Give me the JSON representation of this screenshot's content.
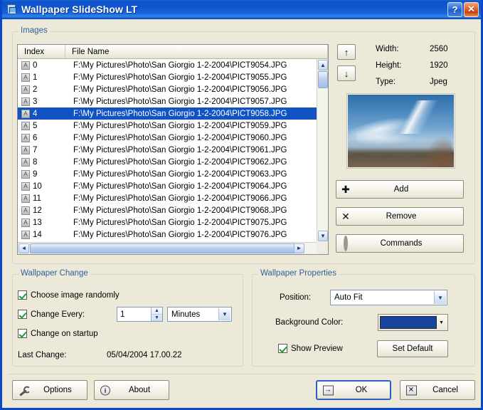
{
  "window": {
    "title": "Wallpaper SlideShow LT",
    "app_icon": "wallpaper-app-icon",
    "help_button": "?",
    "close_button": "✕"
  },
  "images_group": {
    "legend": "Images",
    "columns": [
      "Index",
      "File Name"
    ],
    "row_icon": "A",
    "selected_index": 4,
    "rows": [
      {
        "index": "0",
        "name": "F:\\My Pictures\\Photo\\San Giorgio 1-2-2004\\PICT9054.JPG"
      },
      {
        "index": "1",
        "name": "F:\\My Pictures\\Photo\\San Giorgio 1-2-2004\\PICT9055.JPG"
      },
      {
        "index": "2",
        "name": "F:\\My Pictures\\Photo\\San Giorgio 1-2-2004\\PICT9056.JPG"
      },
      {
        "index": "3",
        "name": "F:\\My Pictures\\Photo\\San Giorgio 1-2-2004\\PICT9057.JPG"
      },
      {
        "index": "4",
        "name": "F:\\My Pictures\\Photo\\San Giorgio 1-2-2004\\PICT9058.JPG"
      },
      {
        "index": "5",
        "name": "F:\\My Pictures\\Photo\\San Giorgio 1-2-2004\\PICT9059.JPG"
      },
      {
        "index": "6",
        "name": "F:\\My Pictures\\Photo\\San Giorgio 1-2-2004\\PICT9060.JPG"
      },
      {
        "index": "7",
        "name": "F:\\My Pictures\\Photo\\San Giorgio 1-2-2004\\PICT9061.JPG"
      },
      {
        "index": "8",
        "name": "F:\\My Pictures\\Photo\\San Giorgio 1-2-2004\\PICT9062.JPG"
      },
      {
        "index": "9",
        "name": "F:\\My Pictures\\Photo\\San Giorgio 1-2-2004\\PICT9063.JPG"
      },
      {
        "index": "10",
        "name": "F:\\My Pictures\\Photo\\San Giorgio 1-2-2004\\PICT9064.JPG"
      },
      {
        "index": "11",
        "name": "F:\\My Pictures\\Photo\\San Giorgio 1-2-2004\\PICT9066.JPG"
      },
      {
        "index": "12",
        "name": "F:\\My Pictures\\Photo\\San Giorgio 1-2-2004\\PICT9068.JPG"
      },
      {
        "index": "13",
        "name": "F:\\My Pictures\\Photo\\San Giorgio 1-2-2004\\PICT9075.JPG"
      },
      {
        "index": "14",
        "name": "F:\\My Pictures\\Photo\\San Giorgio 1-2-2004\\PICT9076.JPG"
      }
    ],
    "move_up": "↑",
    "move_down": "↓",
    "properties": [
      {
        "label": "Width:",
        "value": "2560"
      },
      {
        "label": "Height:",
        "value": "1920"
      },
      {
        "label": "Type:",
        "value": "Jpeg"
      }
    ],
    "buttons": [
      {
        "label": "Add",
        "icon": "plus-icon"
      },
      {
        "label": "Remove",
        "icon": "cross-icon"
      },
      {
        "label": "Commands",
        "icon": "gear-icon"
      }
    ],
    "scroll": {
      "up": "▲",
      "down": "▼",
      "left": "◄",
      "right": "►"
    }
  },
  "wallpaper_change": {
    "legend": "Wallpaper Change",
    "choose_random_label": "Choose image randomly",
    "choose_random_checked": true,
    "change_every_label": "Change Every:",
    "change_every_checked": true,
    "interval_value": "1",
    "interval_unit": "Minutes",
    "change_on_startup_label": "Change on startup",
    "change_on_startup_checked": true,
    "last_change_label": "Last Change:",
    "last_change_value": "05/04/2004 17.00.22"
  },
  "wallpaper_properties": {
    "legend": "Wallpaper Properties",
    "position_label": "Position:",
    "position_value": "Auto Fit",
    "background_color_label": "Background Color:",
    "background_color_value": "#17459e",
    "show_preview_label": "Show Preview",
    "show_preview_checked": true,
    "set_default_label": "Set Default"
  },
  "footer": {
    "options_label": "Options",
    "about_label": "About",
    "ok_label": "OK",
    "cancel_label": "Cancel",
    "ok_icon": "arrow-right-icon",
    "cancel_icon": "cross-box-icon",
    "options_icon": "wrench-icon",
    "about_icon": "info-icon"
  },
  "colors": {
    "title_bar": "#1054cf",
    "selection": "#1253c4",
    "dialog_face": "#ece9d8",
    "group_legend": "#31609c"
  }
}
